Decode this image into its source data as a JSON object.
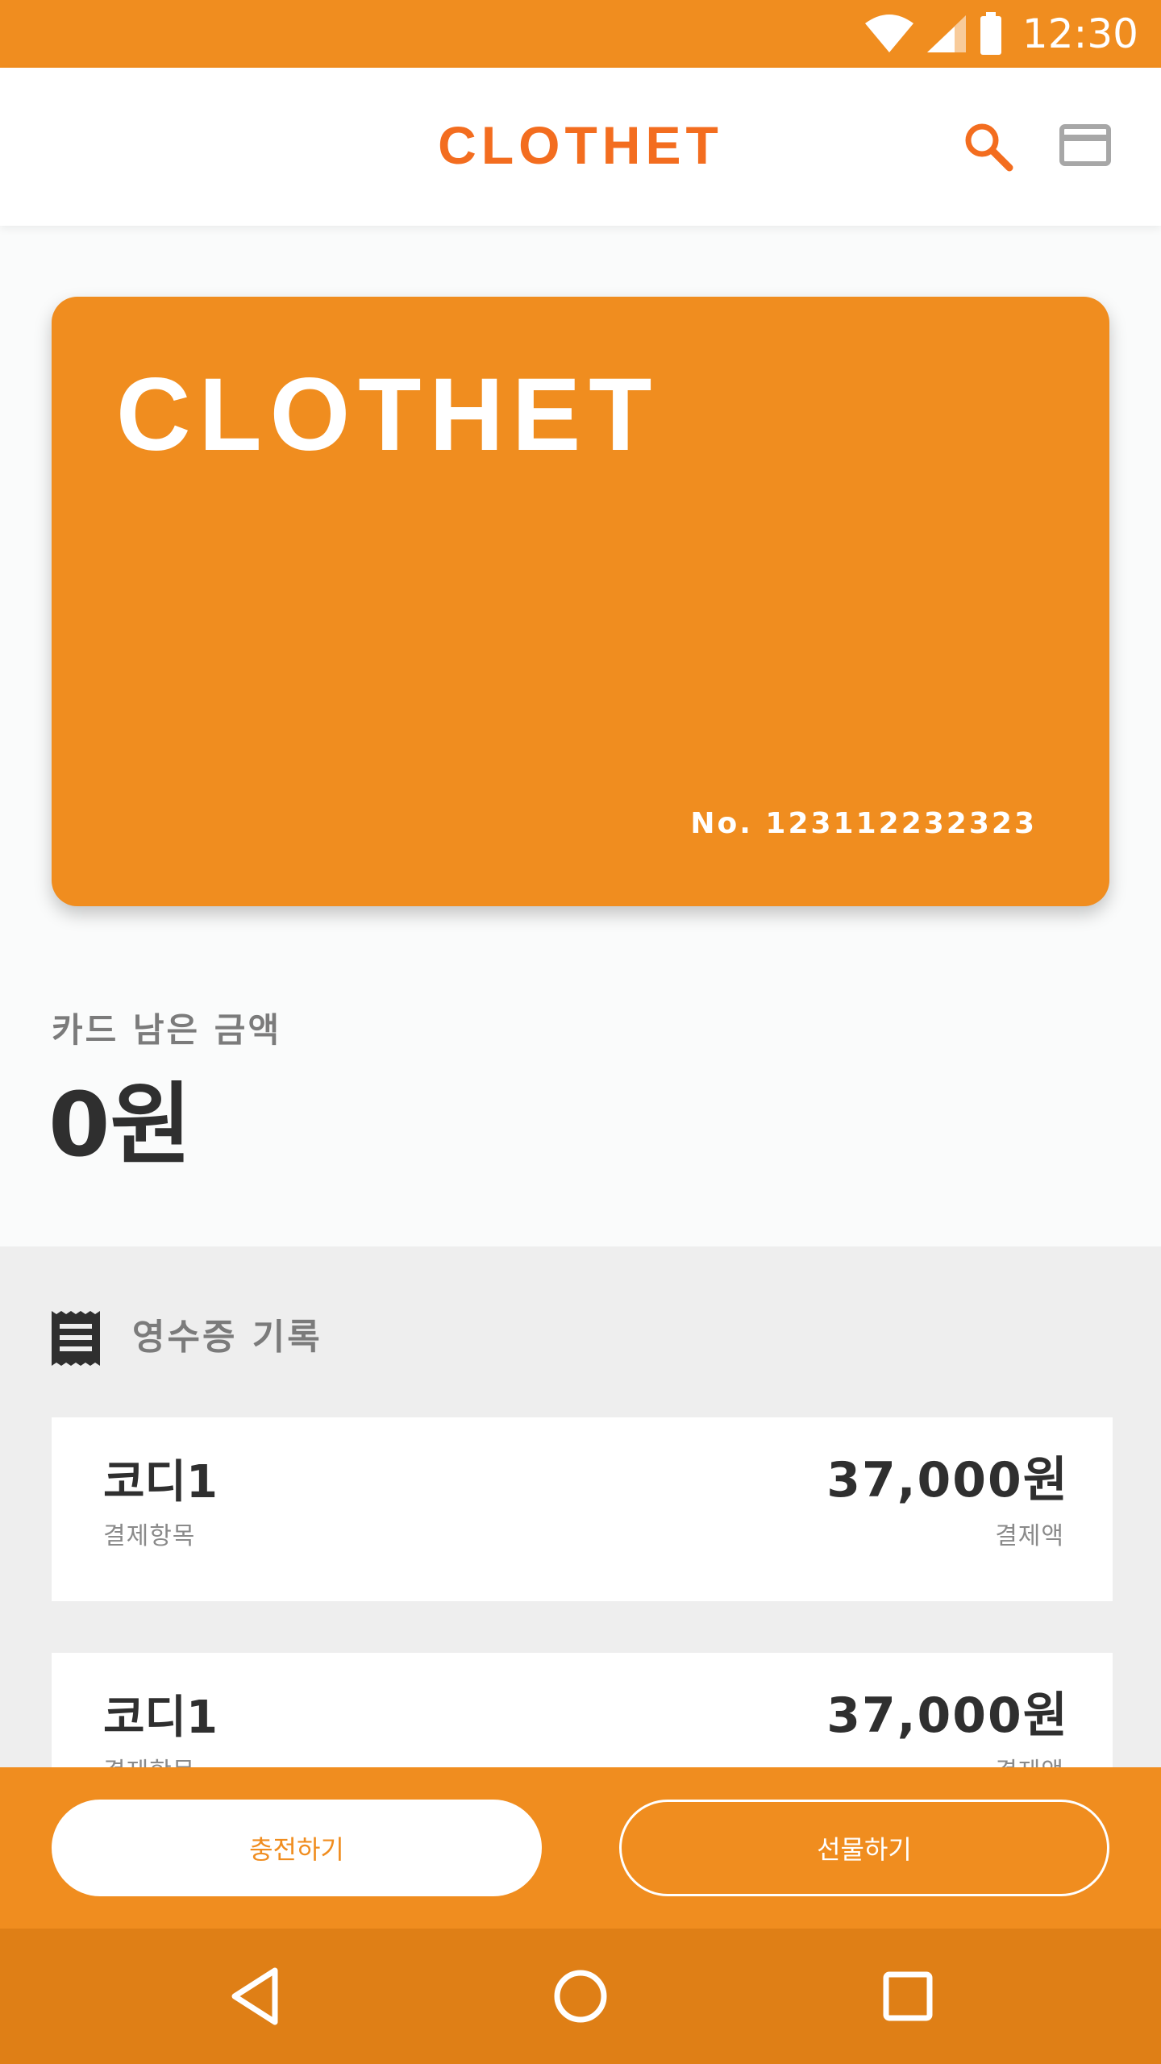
{
  "status_bar": {
    "time": "12:30",
    "icons": [
      "wifi-icon",
      "signal-icon",
      "battery-icon"
    ]
  },
  "app_bar": {
    "logo_text": "CLOTHET",
    "actions": [
      "search-icon",
      "card-icon"
    ]
  },
  "card": {
    "brand": "CLOTHET",
    "number": "No. 123112232323"
  },
  "balance": {
    "label": "카드 남은 금액",
    "value": "0원"
  },
  "receipts": {
    "title": "영수증 기록",
    "items": [
      {
        "name": "코디1",
        "name_caption": "결제항목",
        "amount": "37,000원",
        "amount_caption": "결제액"
      },
      {
        "name": "코디1",
        "name_caption": "결제항목",
        "amount": "37,000원",
        "amount_caption": "결제액"
      }
    ]
  },
  "actions": {
    "charge_label": "충전하기",
    "gift_label": "선물하기"
  },
  "system_nav": [
    "back-icon",
    "home-icon",
    "recents-icon"
  ],
  "colors": {
    "brand_orange": "#f08d1f",
    "logo_orange": "#f36d1f",
    "nav_orange": "#df7f16",
    "text_dark": "#2f2f2f",
    "text_muted": "#7b7b7b"
  }
}
